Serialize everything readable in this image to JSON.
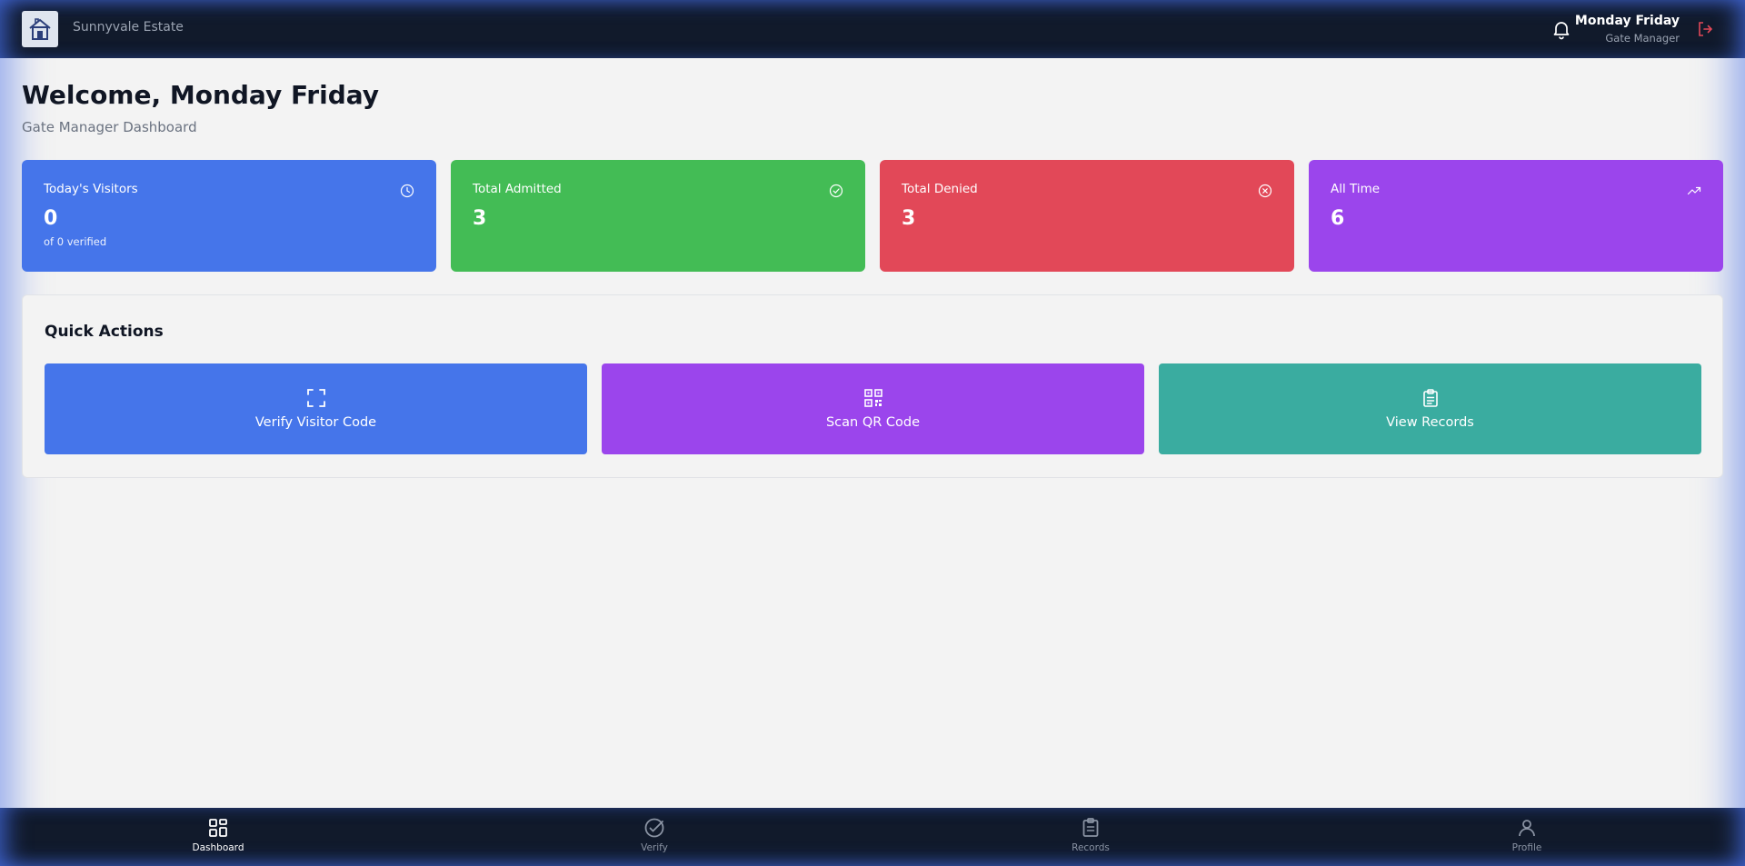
{
  "header": {
    "estate_name": "Sunnyvale Estate",
    "user_name": "Monday Friday",
    "user_role": "Gate Manager",
    "icons": {
      "logo": "estate-logo",
      "bell": "bell-icon",
      "logout": "logout-icon"
    }
  },
  "welcome": {
    "title": "Welcome, Monday Friday",
    "subtitle": "Gate Manager Dashboard"
  },
  "stats": [
    {
      "label": "Today's Visitors",
      "value": "0",
      "sub": "of 0 verified",
      "icon": "clock-icon",
      "color": "#4575ea"
    },
    {
      "label": "Total Admitted",
      "value": "3",
      "sub": "",
      "icon": "check-circle-icon",
      "color": "#43bc55"
    },
    {
      "label": "Total Denied",
      "value": "3",
      "sub": "",
      "icon": "x-circle-icon",
      "color": "#e24858"
    },
    {
      "label": "All Time",
      "value": "6",
      "sub": "",
      "icon": "trending-up-icon",
      "color": "#9b45ec"
    }
  ],
  "quick_actions": {
    "title": "Quick Actions",
    "items": [
      {
        "label": "Verify Visitor Code",
        "icon": "scan-frame-icon",
        "color": "#4575ea"
      },
      {
        "label": "Scan QR Code",
        "icon": "qr-code-icon",
        "color": "#9b45ec"
      },
      {
        "label": "View Records",
        "icon": "clipboard-icon",
        "color": "#3aaca0"
      }
    ]
  },
  "bottom_nav": {
    "items": [
      {
        "label": "Dashboard",
        "icon": "dashboard-icon",
        "active": true
      },
      {
        "label": "Verify",
        "icon": "check-circle-icon",
        "active": false
      },
      {
        "label": "Records",
        "icon": "clipboard-icon",
        "active": false
      },
      {
        "label": "Profile",
        "icon": "user-icon",
        "active": false
      }
    ]
  },
  "colors": {
    "nav_bg": "#111a2b",
    "page_bg": "#f3f3f3",
    "logout_red": "#e24858"
  }
}
